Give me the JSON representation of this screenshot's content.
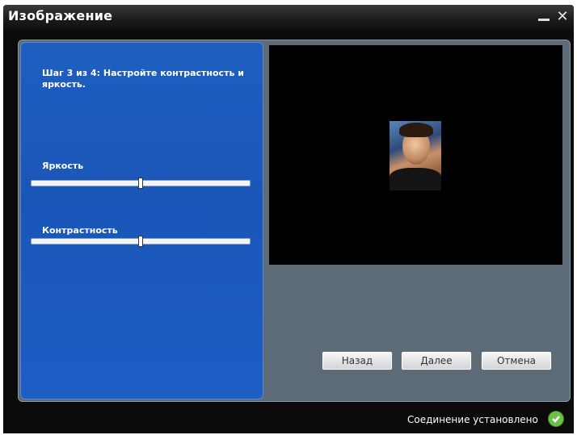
{
  "window": {
    "title": "Изображение"
  },
  "wizard": {
    "step_text": "Шаг 3 из 4: Настройте контрастность и яркость.",
    "brightness": {
      "label": "Яркость",
      "value_fraction": 0.5
    },
    "contrast": {
      "label": "Контрастность",
      "value_fraction": 0.5
    }
  },
  "buttons": {
    "back": "Назад",
    "next": "Далее",
    "cancel": "Отмена"
  },
  "status": {
    "text": "Соединение установлено",
    "icon": "check-icon",
    "color": "#6cc04a"
  }
}
